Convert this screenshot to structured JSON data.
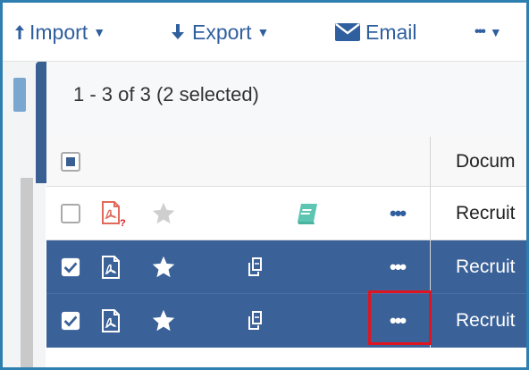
{
  "toolbar": {
    "import_label": "Import",
    "export_label": "Export",
    "email_label": "Email",
    "more_label": "•••"
  },
  "summary": {
    "count_text": "1 - 3 of 3 (2 selected)"
  },
  "table": {
    "columns": [
      {
        "label": "Docum"
      }
    ],
    "rows": [
      {
        "name": "Recruit",
        "selected": false,
        "more": "•••"
      },
      {
        "name": "Recruit",
        "selected": true,
        "more": "•••"
      },
      {
        "name": "Recruit",
        "selected": true,
        "more": "•••"
      }
    ]
  },
  "icons": {
    "pdf_missing": "pdf-missing-icon",
    "pdf": "pdf-icon",
    "star": "star-icon",
    "book": "book-icon",
    "copy": "copy-icon"
  },
  "colors": {
    "selected_row": "#3a6198",
    "accent": "#2f5f9e",
    "highlight": "#e0141e",
    "frame": "#2d7fb0",
    "book": "#5cc6b2",
    "pdf_missing": "#e06a5a"
  }
}
